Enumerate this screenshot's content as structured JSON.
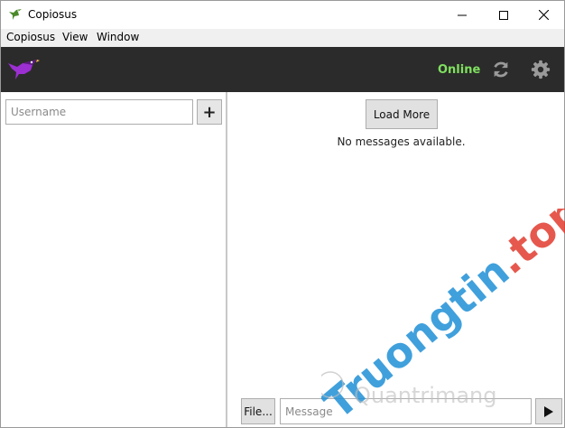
{
  "window": {
    "title": "Copiosus",
    "controls": [
      "minimize-icon",
      "maximize-icon",
      "close-icon"
    ]
  },
  "menu": {
    "items": [
      {
        "label": "Copiosus"
      },
      {
        "label": "View"
      },
      {
        "label": "Window"
      }
    ]
  },
  "toolbar": {
    "status": "Online",
    "status_color": "#7fe05f",
    "icons": [
      "bird-logo-icon",
      "refresh-icon",
      "settings-gear-icon"
    ]
  },
  "sidebar": {
    "username_placeholder": "Username",
    "add_label": "+"
  },
  "main": {
    "load_more_label": "Load More",
    "empty_text": "No messages available.",
    "file_label": "File...",
    "message_placeholder": "Message"
  },
  "watermark": {
    "text": "Truongtin.top",
    "subtext": "Quantrimang"
  }
}
